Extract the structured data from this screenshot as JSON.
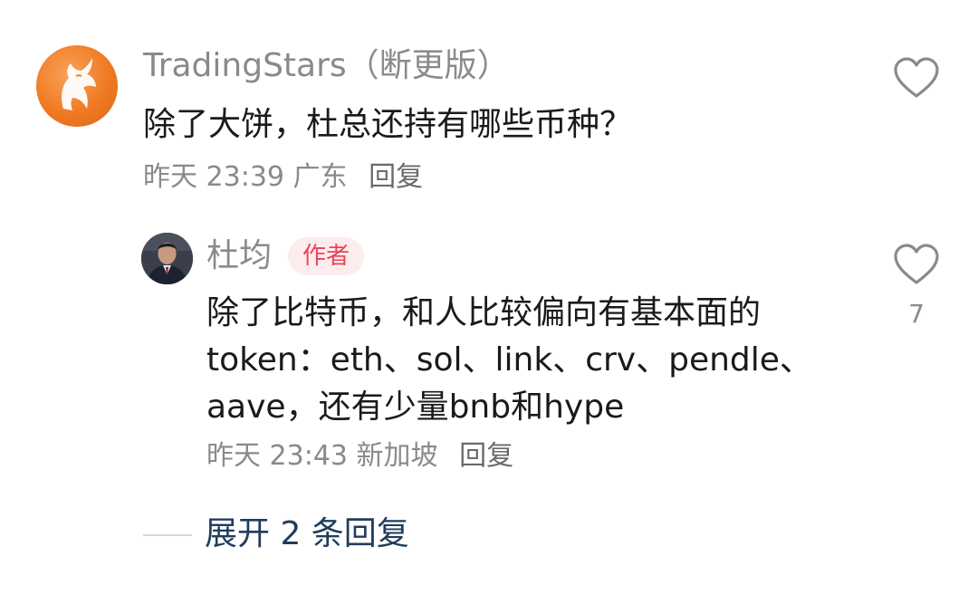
{
  "comment": {
    "username": "TradingStars（断更版）",
    "text": "除了大饼，杜总还持有哪些币种？",
    "time": "昨天 23:39",
    "location": "广东",
    "reply_label": "回复",
    "avatar_icon": "horse-logo-icon",
    "like_count": ""
  },
  "reply": {
    "username": "杜均",
    "badge": "作者",
    "text_lines": [
      "除了比特币，和人比较偏向有基本面的",
      "token：eth、sol、link、crv、pendle、",
      "aave，还有少量bnb和hype"
    ],
    "time": "昨天 23:43",
    "location": "新加坡",
    "reply_label": "回复",
    "like_count": "7"
  },
  "expand": {
    "label": "展开 2 条回复"
  },
  "colors": {
    "muted": "#8a8a8a",
    "badge_bg": "#fdecee",
    "badge_text": "#e8445a",
    "expand_text": "#1f3d5c",
    "avatar_orange": "#ef7a22"
  }
}
